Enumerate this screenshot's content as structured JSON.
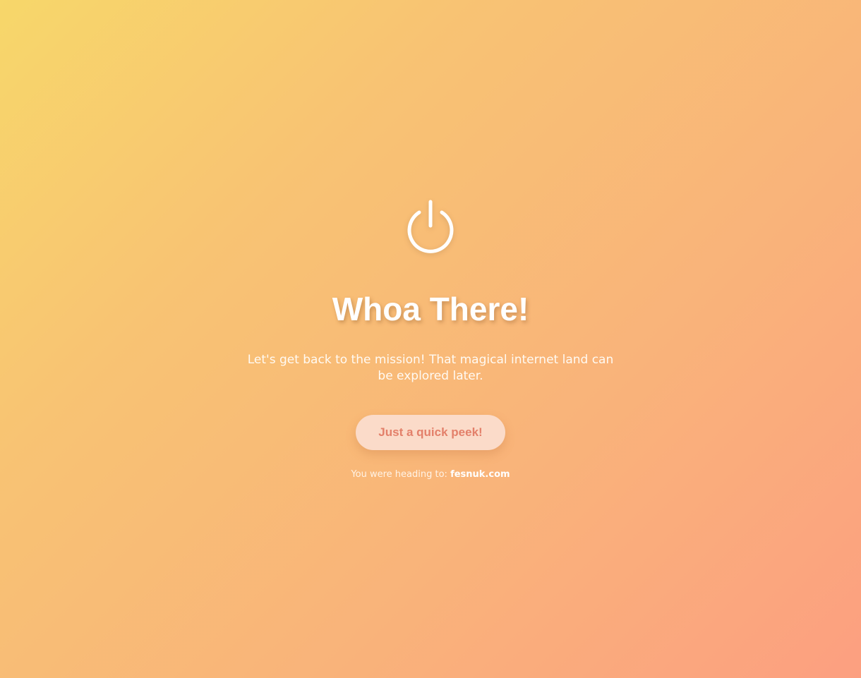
{
  "colors": {
    "gradient_start": "#f7d76a",
    "gradient_end": "#fc9f80",
    "text": "#ffffff",
    "button_background": "#fbdbc9",
    "button_text": "#e3806a"
  },
  "icon": "power-icon",
  "headline": "Whoa There!",
  "message": "Let's get back to the mission! That magical internet land can be explored later.",
  "button": {
    "label": "Just a quick peek!"
  },
  "destination": {
    "prefix": "You were heading to:",
    "domain": "fesnuk.com"
  }
}
